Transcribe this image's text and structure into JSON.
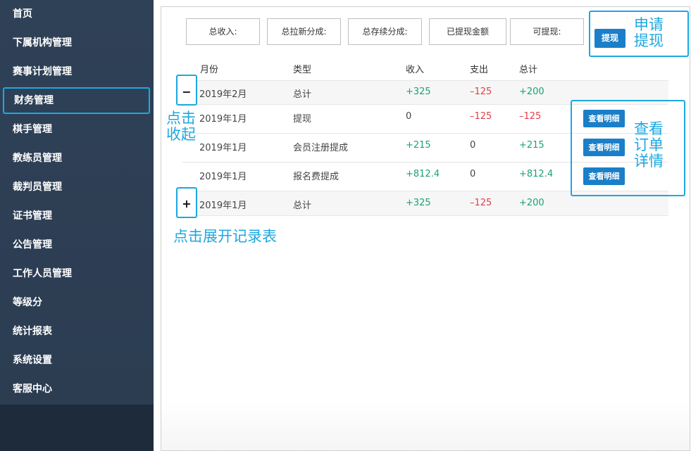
{
  "sidebar": {
    "items": [
      {
        "label": "首页"
      },
      {
        "label": "下属机构管理"
      },
      {
        "label": "赛事计划管理"
      },
      {
        "label": "财务管理"
      },
      {
        "label": "棋手管理"
      },
      {
        "label": "教练员管理"
      },
      {
        "label": "裁判员管理"
      },
      {
        "label": "证书管理"
      },
      {
        "label": "公告管理"
      },
      {
        "label": "工作人员管理"
      },
      {
        "label": "等级分"
      },
      {
        "label": "统计报表"
      },
      {
        "label": "系统设置"
      },
      {
        "label": "客服中心"
      }
    ]
  },
  "stats": {
    "total_income": "总收入:",
    "new_share": "总拉新分成:",
    "renew_share": "总存续分成:",
    "withdrawn": "已提现金额",
    "withdrawable": "可提现:"
  },
  "withdraw_button": "提现",
  "table": {
    "headers": {
      "month": "月份",
      "type": "类型",
      "income": "收入",
      "expense": "支出",
      "total": "总计"
    },
    "rows": [
      {
        "month": "2019年2月",
        "type": "总计",
        "income": "+325",
        "expense": "–125",
        "total": "+200"
      },
      {
        "month": "2019年1月",
        "type": "提现",
        "income": "0",
        "expense": "–125",
        "total": "–125",
        "action": "查看明细"
      },
      {
        "month": "2019年1月",
        "type": "会员注册提成",
        "income": "+215",
        "expense": "0",
        "total": "+215",
        "action": "查看明细"
      },
      {
        "month": "2019年1月",
        "type": "报名费提成",
        "income": "+812.4",
        "expense": "0",
        "total": "+812.4",
        "action": "查看明细"
      },
      {
        "month": "2019年1月",
        "type": "总计",
        "income": "+325",
        "expense": "–125",
        "total": "+200"
      }
    ]
  },
  "toggles": {
    "collapse": "−",
    "expand": "+"
  },
  "annotations": {
    "apply_withdraw": "申请\n提现",
    "click_collapse": "点击\n收起",
    "view_order": "查看\n订单\n详情",
    "click_expand": "点击展开记录表"
  },
  "colors": {
    "accent": "#1ca8e0",
    "button": "#1a7fc8",
    "positive": "#1aa276",
    "negative": "#e0404a",
    "sidebar": "#2f4157"
  }
}
